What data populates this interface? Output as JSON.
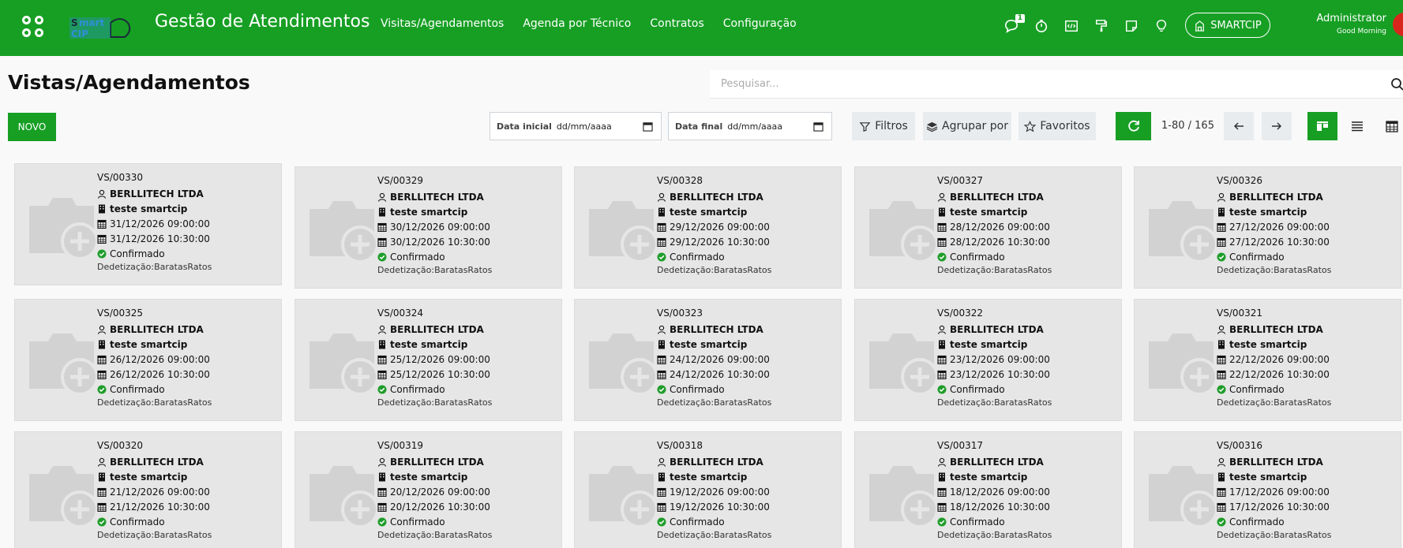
{
  "navbar": {
    "brand": "Gestão de Atendimentos",
    "menu": [
      "Visitas/Agendamentos",
      "Agenda por Técnico",
      "Contratos",
      "Configuração"
    ],
    "messages_badge": "1",
    "company": "SMARTCIP",
    "user_name": "Administrator",
    "user_greeting": "Good Morning",
    "icons": [
      "messages-icon",
      "stopwatch-icon",
      "code-icon",
      "paint-roller-icon",
      "sticky-note-icon",
      "lightbulb-icon"
    ]
  },
  "control": {
    "title": "Vistas/Agendamentos",
    "search_placeholder": "Pesquisar...",
    "new_label": "NOVO",
    "date_start_label": "Data inicial",
    "date_start_value": "dd/mm/aaaa",
    "date_end_label": "Data final",
    "date_end_value": "dd/mm/aaaa",
    "filters_label": "Filtros",
    "groupby_label": "Agrupar por",
    "favorites_label": "Favoritos",
    "pager_value": "1-80 / 165"
  },
  "colors": {
    "brand": "#179f24",
    "card_bg": "#e6e6e6",
    "confirmed": "#1f9d2a"
  },
  "cards": [
    {
      "ref": "VS/00330",
      "partner": "BERLLITECH LTDA",
      "location": "teste smartcip",
      "start": "31/12/2026 09:00:00",
      "end": "31/12/2026 10:30:00",
      "status": "Confirmado",
      "service": "Dedetização:BaratasRatos"
    },
    {
      "ref": "VS/00329",
      "partner": "BERLLITECH LTDA",
      "location": "teste smartcip",
      "start": "30/12/2026 09:00:00",
      "end": "30/12/2026 10:30:00",
      "status": "Confirmado",
      "service": "Dedetização:BaratasRatos"
    },
    {
      "ref": "VS/00328",
      "partner": "BERLLITECH LTDA",
      "location": "teste smartcip",
      "start": "29/12/2026 09:00:00",
      "end": "29/12/2026 10:30:00",
      "status": "Confirmado",
      "service": "Dedetização:BaratasRatos"
    },
    {
      "ref": "VS/00327",
      "partner": "BERLLITECH LTDA",
      "location": "teste smartcip",
      "start": "28/12/2026 09:00:00",
      "end": "28/12/2026 10:30:00",
      "status": "Confirmado",
      "service": "Dedetização:BaratasRatos"
    },
    {
      "ref": "VS/00326",
      "partner": "BERLLITECH LTDA",
      "location": "teste smartcip",
      "start": "27/12/2026 09:00:00",
      "end": "27/12/2026 10:30:00",
      "status": "Confirmado",
      "service": "Dedetização:BaratasRatos"
    },
    {
      "ref": "VS/00325",
      "partner": "BERLLITECH LTDA",
      "location": "teste smartcip",
      "start": "26/12/2026 09:00:00",
      "end": "26/12/2026 10:30:00",
      "status": "Confirmado",
      "service": "Dedetização:BaratasRatos"
    },
    {
      "ref": "VS/00324",
      "partner": "BERLLITECH LTDA",
      "location": "teste smartcip",
      "start": "25/12/2026 09:00:00",
      "end": "25/12/2026 10:30:00",
      "status": "Confirmado",
      "service": "Dedetização:BaratasRatos"
    },
    {
      "ref": "VS/00323",
      "partner": "BERLLITECH LTDA",
      "location": "teste smartcip",
      "start": "24/12/2026 09:00:00",
      "end": "24/12/2026 10:30:00",
      "status": "Confirmado",
      "service": "Dedetização:BaratasRatos"
    },
    {
      "ref": "VS/00322",
      "partner": "BERLLITECH LTDA",
      "location": "teste smartcip",
      "start": "23/12/2026 09:00:00",
      "end": "23/12/2026 10:30:00",
      "status": "Confirmado",
      "service": "Dedetização:BaratasRatos"
    },
    {
      "ref": "VS/00321",
      "partner": "BERLLITECH LTDA",
      "location": "teste smartcip",
      "start": "22/12/2026 09:00:00",
      "end": "22/12/2026 10:30:00",
      "status": "Confirmado",
      "service": "Dedetização:BaratasRatos"
    },
    {
      "ref": "VS/00320",
      "partner": "BERLLITECH LTDA",
      "location": "teste smartcip",
      "start": "21/12/2026 09:00:00",
      "end": "21/12/2026 10:30:00",
      "status": "Confirmado",
      "service": "Dedetização:BaratasRatos"
    },
    {
      "ref": "VS/00319",
      "partner": "BERLLITECH LTDA",
      "location": "teste smartcip",
      "start": "20/12/2026 09:00:00",
      "end": "20/12/2026 10:30:00",
      "status": "Confirmado",
      "service": "Dedetização:BaratasRatos"
    },
    {
      "ref": "VS/00318",
      "partner": "BERLLITECH LTDA",
      "location": "teste smartcip",
      "start": "19/12/2026 09:00:00",
      "end": "19/12/2026 10:30:00",
      "status": "Confirmado",
      "service": "Dedetização:BaratasRatos"
    },
    {
      "ref": "VS/00317",
      "partner": "BERLLITECH LTDA",
      "location": "teste smartcip",
      "start": "18/12/2026 09:00:00",
      "end": "18/12/2026 10:30:00",
      "status": "Confirmado",
      "service": "Dedetização:BaratasRatos"
    },
    {
      "ref": "VS/00316",
      "partner": "BERLLITECH LTDA",
      "location": "teste smartcip",
      "start": "17/12/2026 09:00:00",
      "end": "17/12/2026 10:30:00",
      "status": "Confirmado",
      "service": "Dedetização:BaratasRatos"
    }
  ]
}
